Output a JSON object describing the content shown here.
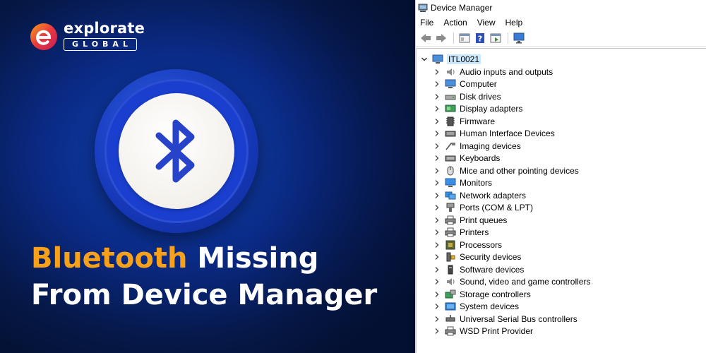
{
  "hero": {
    "logo": {
      "word": "explorate",
      "sub": "GLOBAL"
    },
    "headline": {
      "accent": "Bluetooth",
      "line1_rest": " Missing",
      "line2": "From Device Manager"
    },
    "colors": {
      "accent": "#f7a11b",
      "bluetooth_blue": "#2743c9",
      "background": "#0a2a85"
    },
    "icon": "bluetooth-icon"
  },
  "window": {
    "title": "Device Manager",
    "menu": [
      "File",
      "Action",
      "View",
      "Help"
    ],
    "toolbar_icons": [
      "back-arrow-icon",
      "forward-arrow-icon",
      "properties-icon",
      "help-icon",
      "update-driver-icon",
      "monitor-scan-icon"
    ],
    "tree": {
      "root": {
        "label": "ITL0021",
        "icon": "computer-icon",
        "expanded": true
      },
      "items": [
        {
          "label": "Audio inputs and outputs",
          "icon": "speaker-icon"
        },
        {
          "label": "Computer",
          "icon": "computer-icon"
        },
        {
          "label": "Disk drives",
          "icon": "disk-drive-icon"
        },
        {
          "label": "Display adapters",
          "icon": "display-adapter-icon"
        },
        {
          "label": "Firmware",
          "icon": "firmware-icon"
        },
        {
          "label": "Human Interface Devices",
          "icon": "hid-icon"
        },
        {
          "label": "Imaging devices",
          "icon": "camera-icon"
        },
        {
          "label": "Keyboards",
          "icon": "keyboard-icon"
        },
        {
          "label": "Mice and other pointing devices",
          "icon": "mouse-icon"
        },
        {
          "label": "Monitors",
          "icon": "monitor-icon"
        },
        {
          "label": "Network adapters",
          "icon": "network-icon"
        },
        {
          "label": "Ports (COM & LPT)",
          "icon": "port-icon"
        },
        {
          "label": "Print queues",
          "icon": "print-queue-icon"
        },
        {
          "label": "Printers",
          "icon": "printer-icon"
        },
        {
          "label": "Processors",
          "icon": "processor-icon"
        },
        {
          "label": "Security devices",
          "icon": "security-icon"
        },
        {
          "label": "Software devices",
          "icon": "software-device-icon"
        },
        {
          "label": "Sound, video and game controllers",
          "icon": "sound-icon"
        },
        {
          "label": "Storage controllers",
          "icon": "storage-icon"
        },
        {
          "label": "System devices",
          "icon": "system-icon"
        },
        {
          "label": "Universal Serial Bus controllers",
          "icon": "usb-icon"
        },
        {
          "label": "WSD Print Provider",
          "icon": "wsd-printer-icon"
        }
      ]
    }
  }
}
